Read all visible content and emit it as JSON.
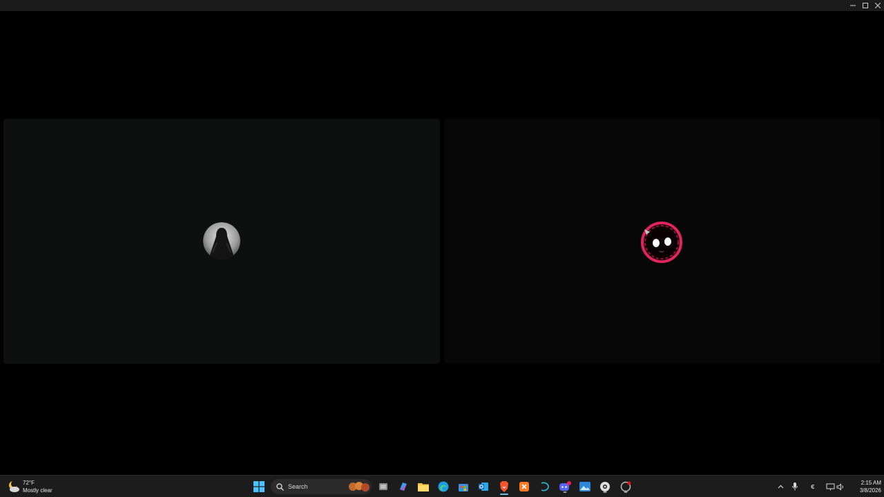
{
  "window": {
    "controls": [
      "minimize-icon",
      "maximize-icon",
      "close-icon"
    ]
  },
  "participants": [
    {
      "id": "left",
      "avatar": "long-haired-figure-avatar"
    },
    {
      "id": "right",
      "avatar": "red-glitch-smiley-avatar"
    }
  ],
  "taskbar": {
    "weather": {
      "temp": "72°F",
      "condition": "Mostly clear",
      "icon": "moon-cloud-icon"
    },
    "search": {
      "label": "Search"
    },
    "apps": [
      "windows-start-icon",
      "task-view-icon",
      "copilot-m365-icon",
      "file-explorer-icon",
      "edge-icon",
      "microsoft-store-icon",
      "outlook-icon",
      "brave-icon",
      "xampp-icon",
      "terminal-icon",
      "discord-icon",
      "photos-icon",
      "steam-icon",
      "ms-teams-icon"
    ],
    "tray": [
      "chevron-up-icon",
      "microphone-icon",
      "keyboard-layout-icon",
      "network-icon",
      "volume-icon"
    ],
    "clock": {
      "time": "2:15 AM",
      "date": "3/8/2026"
    },
    "colors": {
      "accent": "#76b9ed",
      "discord_badge": "#e0245e"
    }
  }
}
